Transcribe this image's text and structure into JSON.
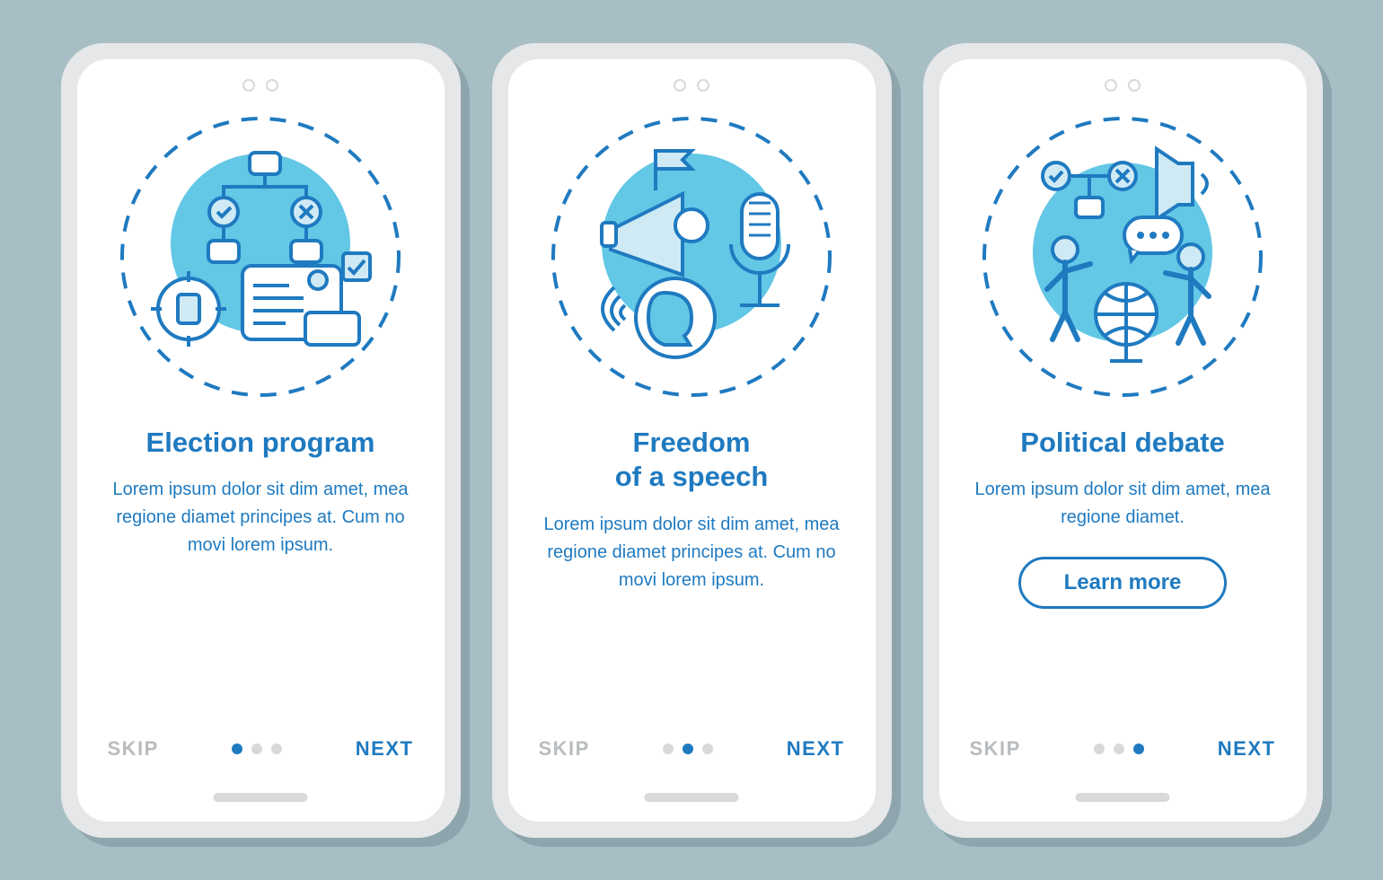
{
  "colors": {
    "accent": "#1f7ac0",
    "muted": "#b9bcbf",
    "bg": "#a7bec5"
  },
  "screens": [
    {
      "title": "Election program",
      "body": "Lorem ipsum dolor sit dim amet, mea regione diamet principes at. Cum no movi lorem ipsum.",
      "skip": "SKIP",
      "next": "NEXT",
      "activeDot": 0,
      "hasLearnMore": false,
      "illustration": "election-program-illustration"
    },
    {
      "title": "Freedom\nof a speech",
      "body": "Lorem ipsum dolor sit dim amet, mea regione diamet principes at. Cum no movi lorem ipsum.",
      "skip": "SKIP",
      "next": "NEXT",
      "activeDot": 1,
      "hasLearnMore": false,
      "illustration": "freedom-of-speech-illustration"
    },
    {
      "title": "Political debate",
      "body": "Lorem ipsum dolor sit dim amet, mea regione diamet.",
      "skip": "SKIP",
      "next": "NEXT",
      "activeDot": 2,
      "hasLearnMore": true,
      "learnMoreLabel": "Learn more",
      "illustration": "political-debate-illustration"
    }
  ]
}
